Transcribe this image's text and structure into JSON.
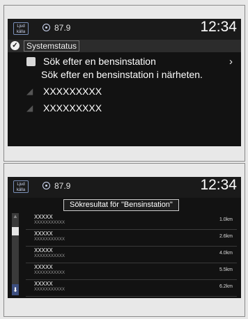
{
  "screen1": {
    "header": {
      "source_button": "Ljud källa",
      "radio_frequency": "87.9",
      "clock": "12:34"
    },
    "status_title": "Systemstatus",
    "menu": [
      {
        "icon": "fuel-pump-icon",
        "label": "Sök efter en bensinstation"
      },
      {
        "icon": "dim-icon",
        "label": "XXXXXXXXX"
      },
      {
        "icon": "dim-icon",
        "label": "XXXXXXXXX"
      }
    ],
    "tooltip": "Sök efter en bensinstation i närheten."
  },
  "screen2": {
    "header": {
      "source_button": "Ljud källa",
      "radio_frequency": "87.9",
      "clock": "12:34"
    },
    "results_title": "Sökresultat för \"Bensinstation\"",
    "results": [
      {
        "name": "XXXXX",
        "address": "XXXXXXXXXXX",
        "distance": "1.0km"
      },
      {
        "name": "XXXXX",
        "address": "XXXXXXXXXXX",
        "distance": "2.6km"
      },
      {
        "name": "XXXXX",
        "address": "XXXXXXXXXXX",
        "distance": "4.0km"
      },
      {
        "name": "XXXXX",
        "address": "XXXXXXXXXXX",
        "distance": "5.5km"
      },
      {
        "name": "XXXXX",
        "address": "XXXXXXXXXXX",
        "distance": "6.2km"
      }
    ]
  }
}
